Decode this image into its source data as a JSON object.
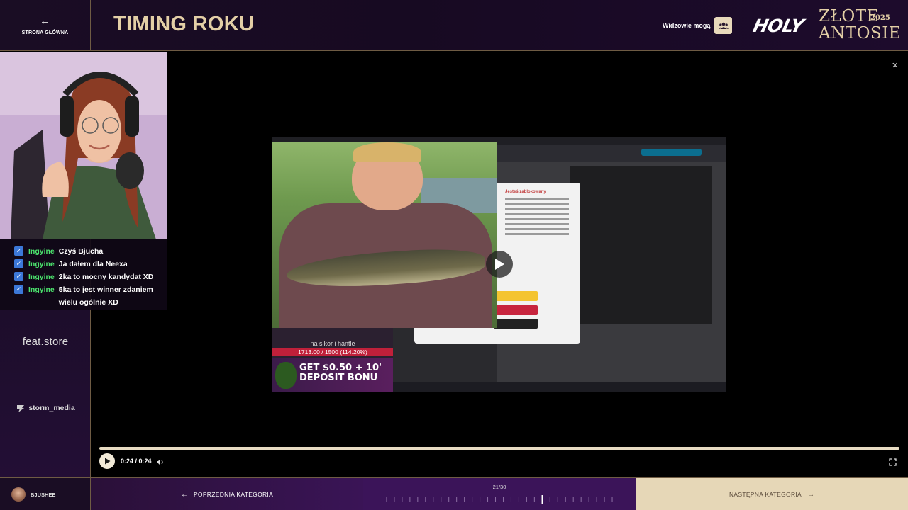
{
  "header": {
    "home_label": "STRONA GŁÓWNA",
    "title": "TIMING ROKU",
    "viewers_label": "Widzowie mogą",
    "brand_holy": "HOLY",
    "brand_event": "ZŁOTE\nANTOSIE",
    "brand_year": "2025"
  },
  "chat": [
    {
      "user": "Ingyine",
      "message": "Czyś Bjucha"
    },
    {
      "user": "Ingyine",
      "message": "Ja dałem dla Neexa"
    },
    {
      "user": "Ingyine",
      "message": "2ka to mocny kandydat XD"
    },
    {
      "user": "Ingyine",
      "message": "5ka to jest winner zdaniem wielu ogólnie XD"
    }
  ],
  "sponsors": {
    "feat": "feat.store",
    "storm": "storm_media"
  },
  "video": {
    "dialog_title": "Jesteś zablokowany",
    "overlay_caption": "na sikor i hantle",
    "overlay_progress": "1713.00 / 1500 (114.20%)",
    "overlay_progress_fraction": 1.142,
    "ad_text": "GET $0.50 + 10' DEPOSIT BONU",
    "time_display": "0:24 / 0:24",
    "playback_fraction": 1.0
  },
  "footer": {
    "username": "BJUSHEE",
    "prev_label": "POPRZEDNIA KATEGORIA",
    "counter": "21/30",
    "current_index": 21,
    "total": 30,
    "next_label": "NASTĘPNA KATEGORIA"
  },
  "colors": {
    "accent_gold": "#e3cfa6",
    "chat_user": "#4be36d",
    "prev_bg": "#3a1456",
    "next_bg": "#e6d7b7"
  }
}
